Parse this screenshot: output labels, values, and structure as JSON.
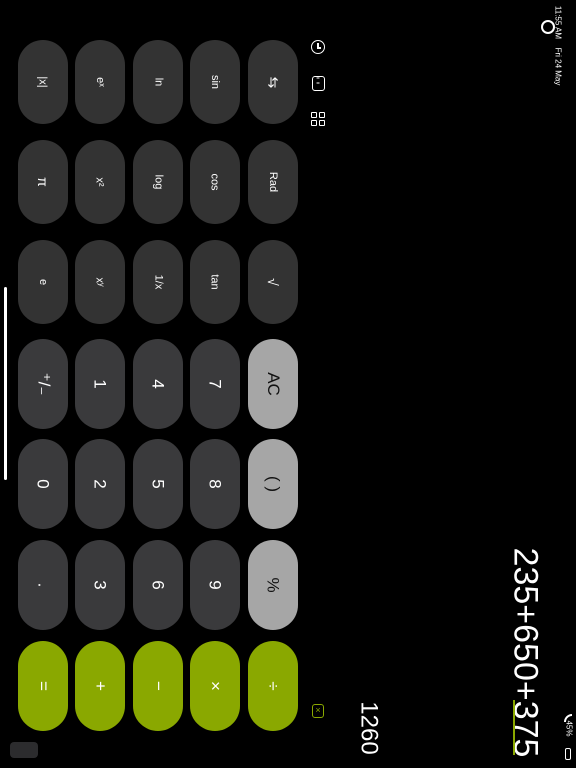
{
  "status_bar": {
    "time": "11:55 AM",
    "date": "Fri 24 May",
    "battery": "45%"
  },
  "display": {
    "expression": "235+650+375",
    "result": "1260"
  },
  "toolbar": {
    "history_icon": "clock-icon",
    "converter_icon": "converter-icon",
    "grid_icon": "grid-icon",
    "backspace_icon": "backspace-icon"
  },
  "keys": {
    "swap": "⇆",
    "rad": "Rad",
    "root": "√",
    "sin": "sin",
    "cos": "cos",
    "tan": "tan",
    "ln": "ln",
    "log": "log",
    "reciprocal": "1/x",
    "ex": "eˣ",
    "x2": "x²",
    "xy": "xʸ",
    "abs": "|x|",
    "pi": "π",
    "e": "e",
    "ac": "AC",
    "paren": "( )",
    "percent": "%",
    "divide": "÷",
    "n7": "7",
    "n8": "8",
    "n9": "9",
    "multiply": "×",
    "n4": "4",
    "n5": "5",
    "n6": "6",
    "minus": "−",
    "n1": "1",
    "n2": "2",
    "n3": "3",
    "plus": "+",
    "sign": "⁺/₋",
    "n0": "0",
    "dot": ".",
    "equals": "="
  },
  "colors": {
    "background": "#000000",
    "function_key": "#333333",
    "number_key": "#3a3a3c",
    "light_key": "#a6a6a6",
    "accent": "#8aa800"
  }
}
